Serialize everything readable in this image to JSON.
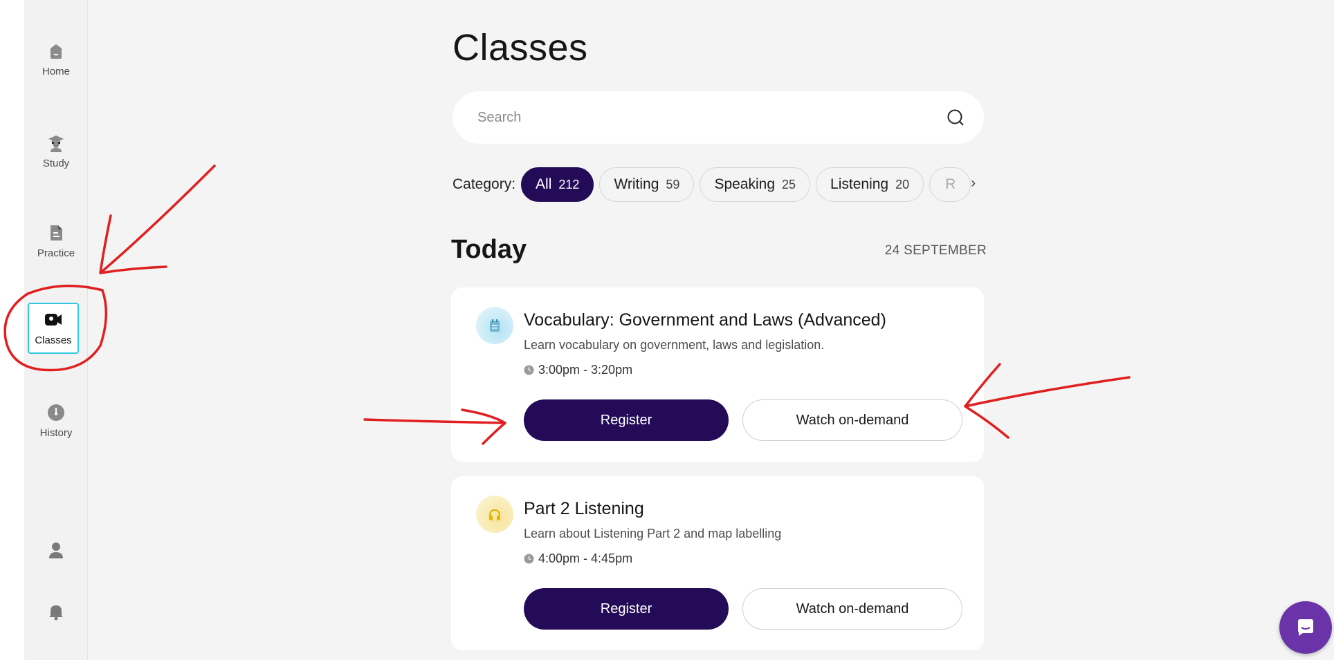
{
  "sidebar": {
    "items": [
      {
        "label": "Home",
        "icon": "home-icon"
      },
      {
        "label": "Study",
        "icon": "graduate-icon"
      },
      {
        "label": "Practice",
        "icon": "document-icon"
      },
      {
        "label": "Classes",
        "icon": "video-camera-icon",
        "active": true
      },
      {
        "label": "History",
        "icon": "history-icon"
      }
    ],
    "bottom_icons": [
      "profile-icon",
      "bell-icon"
    ]
  },
  "page": {
    "title": "Classes",
    "search_placeholder": "Search"
  },
  "categories": {
    "label": "Category:",
    "chips": [
      {
        "label": "All",
        "count": "212",
        "active": true
      },
      {
        "label": "Writing",
        "count": "59"
      },
      {
        "label": "Speaking",
        "count": "25"
      },
      {
        "label": "Listening",
        "count": "20"
      },
      {
        "label": "R",
        "count": ""
      }
    ]
  },
  "section": {
    "title": "Today",
    "date": "24 SEPTEMBER"
  },
  "classes": [
    {
      "title": "Vocabulary: Government and Laws (Advanced)",
      "description": "Learn vocabulary on government, laws and legislation.",
      "time": "3:00pm - 3:20pm",
      "register_label": "Register",
      "watch_label": "Watch on-demand",
      "thumb_color": "#c9ecf7"
    },
    {
      "title": "Part 2 Listening",
      "description": "Learn about Listening Part 2 and map labelling",
      "time": "4:00pm - 4:45pm",
      "register_label": "Register",
      "watch_label": "Watch on-demand",
      "thumb_color": "#fbf0c4"
    }
  ],
  "colors": {
    "primary": "#230b58",
    "accent_active_border": "#34c6e0",
    "chat_button": "#6a33a8",
    "annotation": "#e02020"
  }
}
